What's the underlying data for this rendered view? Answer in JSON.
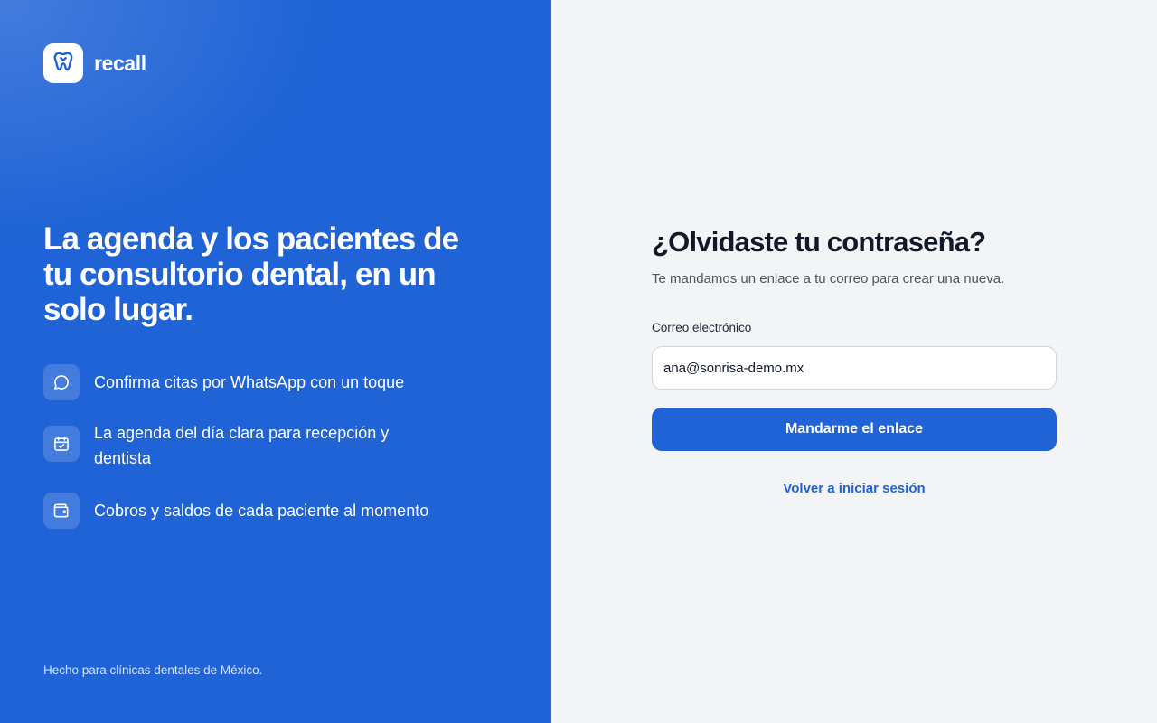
{
  "brand": {
    "name": "recall",
    "logo_icon": "tooth-icon"
  },
  "hero": {
    "headline": "La agenda y los pacientes de tu consultorio dental, en un solo lugar.",
    "features": [
      {
        "icon": "chat-bubble-icon",
        "text": "Confirma citas por WhatsApp con un toque"
      },
      {
        "icon": "calendar-check-icon",
        "text": "La agenda del día clara para recepción y dentista"
      },
      {
        "icon": "wallet-icon",
        "text": "Cobros y saldos de cada paciente al momento"
      }
    ],
    "footer_note": "Hecho para clínicas dentales de México."
  },
  "form": {
    "title": "¿Olvidaste tu contraseña?",
    "subtitle": "Te mandamos un enlace a tu correo para crear una nueva.",
    "email_label": "Correo electrónico",
    "email_value": "ana@sonrisa-demo.mx",
    "submit_label": "Mandarme el enlace",
    "back_link_label": "Volver a iniciar sesión"
  },
  "colors": {
    "brand_blue": "#1f63d6",
    "panel_background": "#f3f4f6",
    "title_text": "#111827"
  }
}
